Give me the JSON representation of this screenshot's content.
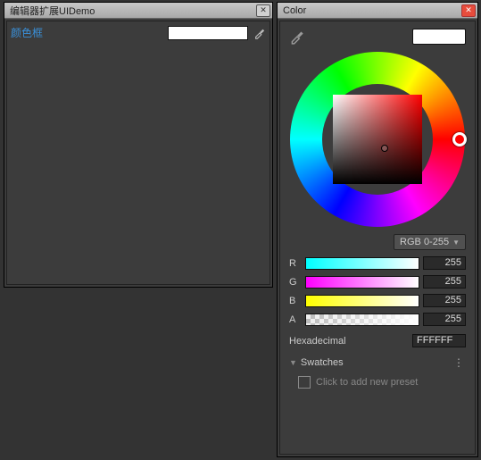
{
  "left_panel": {
    "title": "编辑器扩展UIDemo",
    "field_label": "颜色框",
    "swatch_color": "#ffffff"
  },
  "color_picker": {
    "title": "Color",
    "picked_color": "#ffffff",
    "mode_label": "RGB 0-255",
    "channels": {
      "r": {
        "label": "R",
        "value": "255"
      },
      "g": {
        "label": "G",
        "value": "255"
      },
      "b": {
        "label": "B",
        "value": "255"
      },
      "a": {
        "label": "A",
        "value": "255"
      }
    },
    "hex_label": "Hexadecimal",
    "hex_value": "FFFFFF",
    "swatches_label": "Swatches",
    "add_preset_label": "Click to add new preset"
  }
}
